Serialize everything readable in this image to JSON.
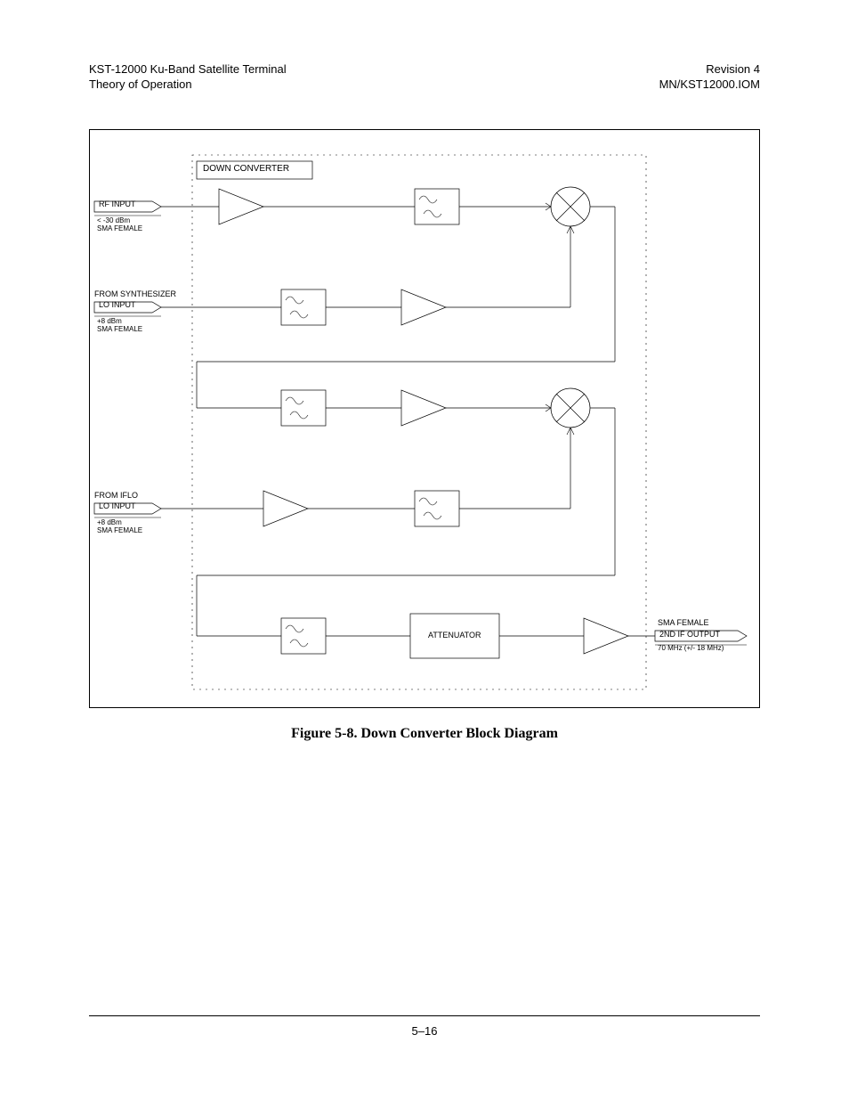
{
  "header": {
    "left_line1": "KST-12000 Ku-Band Satellite Terminal",
    "left_line2": "Theory of Operation",
    "right_line1": "Revision 4",
    "right_line2": "MN/KST12000.IOM"
  },
  "diagram": {
    "block_title": "DOWN CONVERTER",
    "rf_input": {
      "label": "RF INPUT",
      "spec1": "< -30 dBm",
      "spec2": "SMA FEMALE"
    },
    "from_synth": {
      "source": "FROM SYNTHESIZER",
      "label": "LO INPUT",
      "spec1": "+8 dBm",
      "spec2": "SMA FEMALE"
    },
    "from_iflo": {
      "source": "FROM IFLO",
      "label": "LO INPUT",
      "spec1": "+8 dBm",
      "spec2": "SMA FEMALE"
    },
    "attenuator": "ATTENUATOR",
    "output": {
      "connector": "SMA FEMALE",
      "label": "2ND IF OUTPUT",
      "spec": "70 MHz (+/- 18 MHz)"
    }
  },
  "caption": "Figure 5-8.  Down Converter Block Diagram",
  "page_number": "5–16"
}
